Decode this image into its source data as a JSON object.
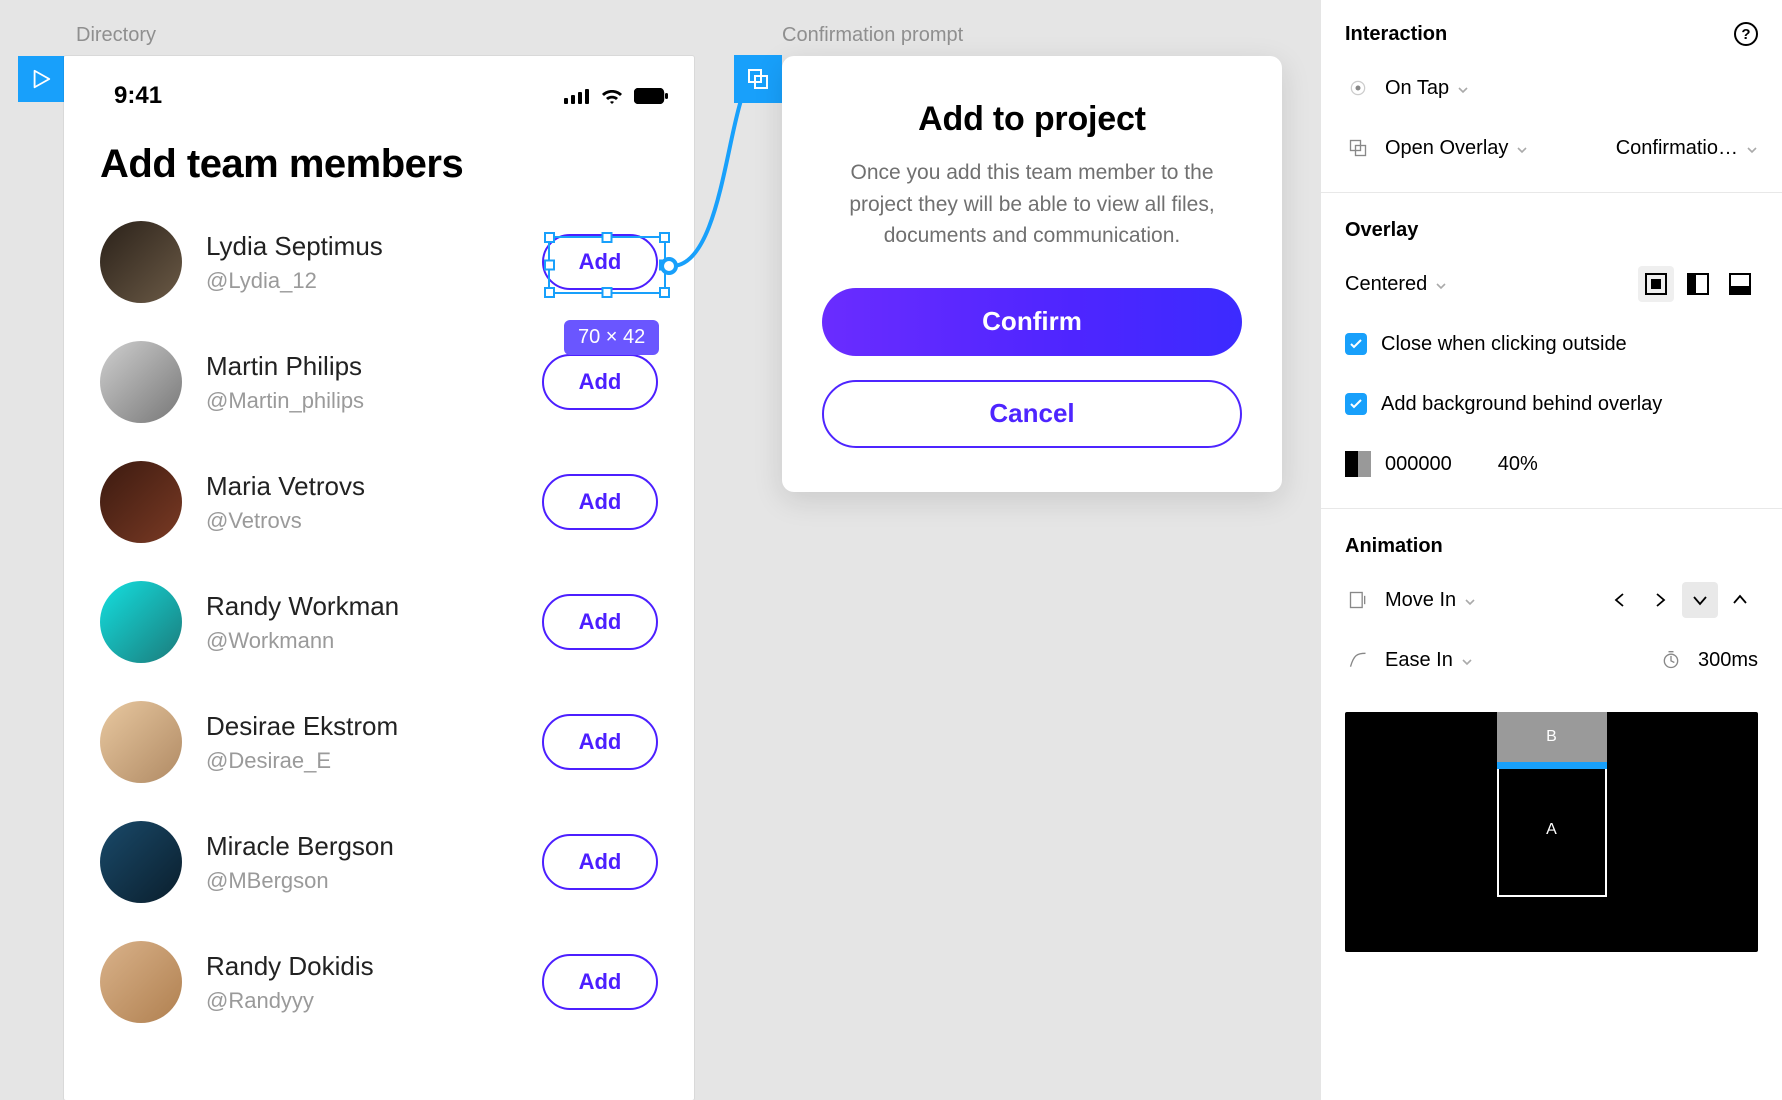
{
  "canvas": {
    "directory_label": "Directory",
    "confirmation_label": "Confirmation prompt",
    "selection_size": "70 × 42"
  },
  "directory": {
    "status_time": "9:41",
    "title": "Add team members",
    "add_label": "Add",
    "members": [
      {
        "name": "Lydia Septimus",
        "handle": "@Lydia_12"
      },
      {
        "name": "Martin Philips",
        "handle": "@Martin_philips"
      },
      {
        "name": "Maria Vetrovs",
        "handle": "@Vetrovs"
      },
      {
        "name": "Randy Workman",
        "handle": "@Workmann"
      },
      {
        "name": "Desirae Ekstrom",
        "handle": "@Desirae_E"
      },
      {
        "name": "Miracle Bergson",
        "handle": "@MBergson"
      },
      {
        "name": "Randy Dokidis",
        "handle": "@Randyyy"
      }
    ]
  },
  "confirm": {
    "title": "Add to project",
    "body": "Once you add this team member to the project they will be able to view all files, documents and communication.",
    "confirm_label": "Confirm",
    "cancel_label": "Cancel"
  },
  "inspector": {
    "interaction_header": "Interaction",
    "trigger": "On Tap",
    "action": "Open Overlay",
    "target": "Confirmatio…",
    "overlay_header": "Overlay",
    "position": "Centered",
    "close_outside": "Close when clicking outside",
    "add_bg": "Add background behind overlay",
    "bg_hex": "000000",
    "bg_opacity": "40%",
    "animation_header": "Animation",
    "anim_type": "Move In",
    "easing": "Ease In",
    "duration": "300ms",
    "preview_a": "A",
    "preview_b": "B"
  }
}
